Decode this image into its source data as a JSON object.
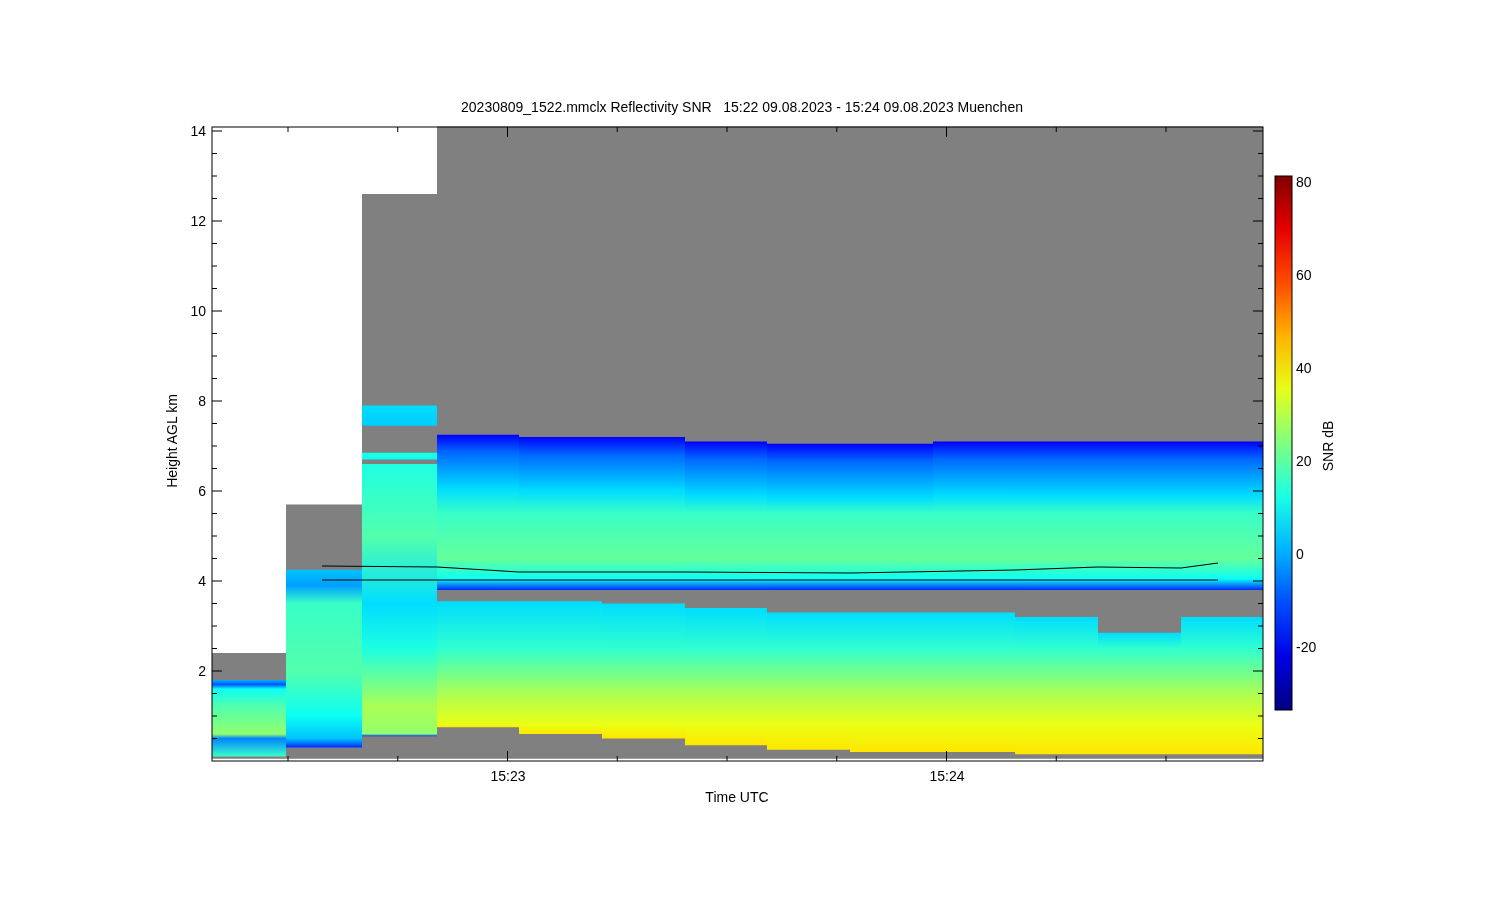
{
  "title": "20230809_1522.mmclx Reflectivity SNR   15:22 09.08.2023 - 15:24 09.08.2023 Muenchen",
  "y_axis": {
    "label": "Height AGL km",
    "ticks": [
      "14",
      "12",
      "10",
      "8",
      "6",
      "4",
      "2"
    ]
  },
  "x_axis": {
    "label": "Time UTC",
    "ticks": [
      "15:23",
      "15:24"
    ]
  },
  "colorbar": {
    "label": "SNR dB",
    "ticks": [
      "80",
      "60",
      "40",
      "20",
      "0",
      "-20"
    ]
  }
}
